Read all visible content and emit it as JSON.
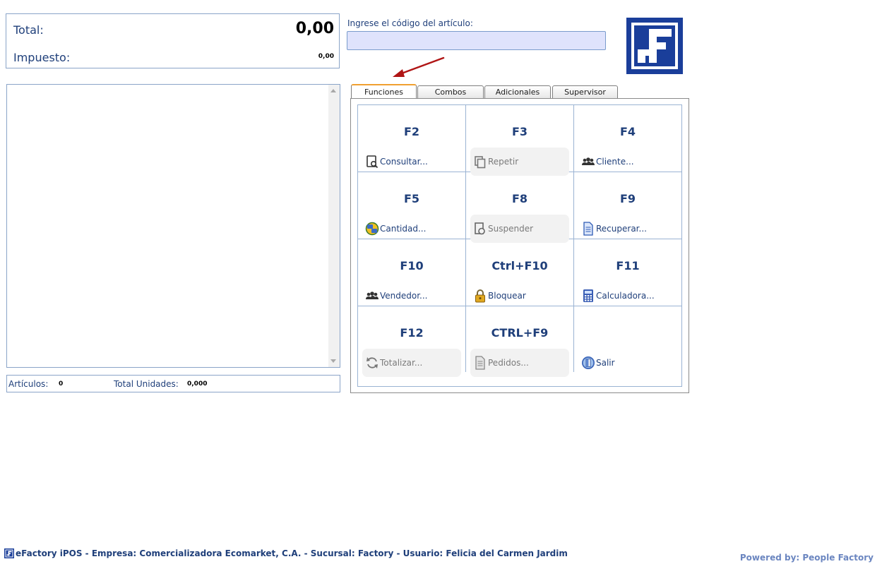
{
  "totals": {
    "total_label": "Total:",
    "total_value": "0,00",
    "tax_label": "Impuesto:",
    "tax_value": "0,00"
  },
  "status": {
    "articles_label": "Artículos:",
    "articles_value": "0",
    "units_label": "Total Unidades:",
    "units_value": "0,000"
  },
  "code_entry": {
    "label": "Ingrese el código del artículo:",
    "value": ""
  },
  "tabs": [
    {
      "label": "Funciones",
      "active": true
    },
    {
      "label": "Combos",
      "active": false
    },
    {
      "label": "Adicionales",
      "active": false
    },
    {
      "label": "Supervisor",
      "active": false
    }
  ],
  "functions": [
    {
      "key": "F2",
      "label": "Consultar...",
      "icon": "search-document-icon",
      "enabled": true
    },
    {
      "key": "F3",
      "label": "Repetir",
      "icon": "copy-icon",
      "enabled": false
    },
    {
      "key": "F4",
      "label": "Cliente...",
      "icon": "users-icon",
      "enabled": true
    },
    {
      "key": "F5",
      "label": "Cantidad...",
      "icon": "exchange-icon",
      "enabled": true
    },
    {
      "key": "F8",
      "label": "Suspender",
      "icon": "suspend-document-icon",
      "enabled": false
    },
    {
      "key": "F9",
      "label": "Recuperar...",
      "icon": "document-icon",
      "enabled": true
    },
    {
      "key": "F10",
      "label": "Vendedor...",
      "icon": "users-icon",
      "enabled": true
    },
    {
      "key": "Ctrl+F10",
      "label": "Bloquear",
      "icon": "lock-icon",
      "enabled": true
    },
    {
      "key": "F11",
      "label": "Calculadora...",
      "icon": "calculator-icon",
      "enabled": true
    },
    {
      "key": "F12",
      "label": "Totalizar...",
      "icon": "refresh-icon",
      "enabled": false
    },
    {
      "key": "CTRL+F9",
      "label": "Pedidos...",
      "icon": "document-icon",
      "enabled": false
    },
    {
      "key": "",
      "label": "Salir",
      "icon": "exit-door-icon",
      "enabled": true
    }
  ],
  "footer": {
    "info": "eFactory iPOS - Empresa: Comercializadora Ecomarket, C.A. - Sucursal: Factory - Usuario: Felicia del Carmen Jardim",
    "powered": "Powered by: People Factory"
  },
  "colors": {
    "brand_blue": "#1a3e9a",
    "text_blue": "#1f3f7a",
    "input_bg": "#dfe3fc",
    "tab_active_accent": "#f0a030",
    "arrow_red": "#b01515"
  }
}
